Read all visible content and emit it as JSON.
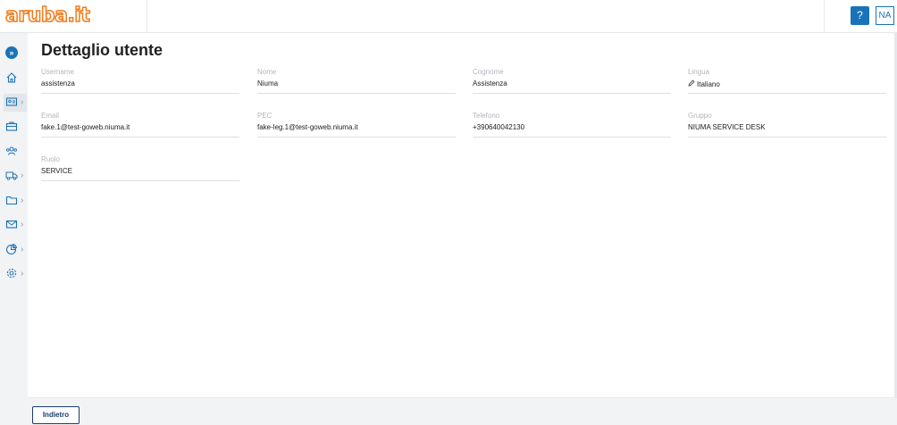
{
  "header": {
    "logo_text": "aruba.it",
    "help_label": "?",
    "user_initials": "NA"
  },
  "sidebar": {
    "expand_icon": "»",
    "items": [
      {
        "icon": "home-icon",
        "has_chevron": false
      },
      {
        "icon": "id-card-icon",
        "has_chevron": true
      },
      {
        "icon": "briefcase-icon",
        "has_chevron": false
      },
      {
        "icon": "users-icon",
        "has_chevron": false
      },
      {
        "icon": "truck-icon",
        "has_chevron": true
      },
      {
        "icon": "folder-icon",
        "has_chevron": true
      },
      {
        "icon": "mail-icon",
        "has_chevron": true
      },
      {
        "icon": "pie-chart-icon",
        "has_chevron": true
      },
      {
        "icon": "gear-icon",
        "has_chevron": true
      }
    ],
    "chevron": "›"
  },
  "page": {
    "title": "Dettaglio utente",
    "fields": {
      "username": {
        "label": "Username",
        "value": "assistenza"
      },
      "nome": {
        "label": "Nome",
        "value": "Niuma"
      },
      "cognome": {
        "label": "Cognome",
        "value": "Assistenza"
      },
      "lingua": {
        "label": "Lingua",
        "value": "Italiano"
      },
      "email": {
        "label": "Email",
        "value": "fake.1@test-goweb.niuma.it"
      },
      "pec": {
        "label": "PEC",
        "value": "fake-leg.1@test-goweb.niuma.it"
      },
      "telefono": {
        "label": "Telefono",
        "value": "+390640042130"
      },
      "gruppo": {
        "label": "Gruppo",
        "value": "NIUMA SERVICE DESK"
      },
      "ruolo": {
        "label": "Ruolo",
        "value": "SERVICE"
      }
    }
  },
  "footer": {
    "back_label": "Indietro"
  }
}
